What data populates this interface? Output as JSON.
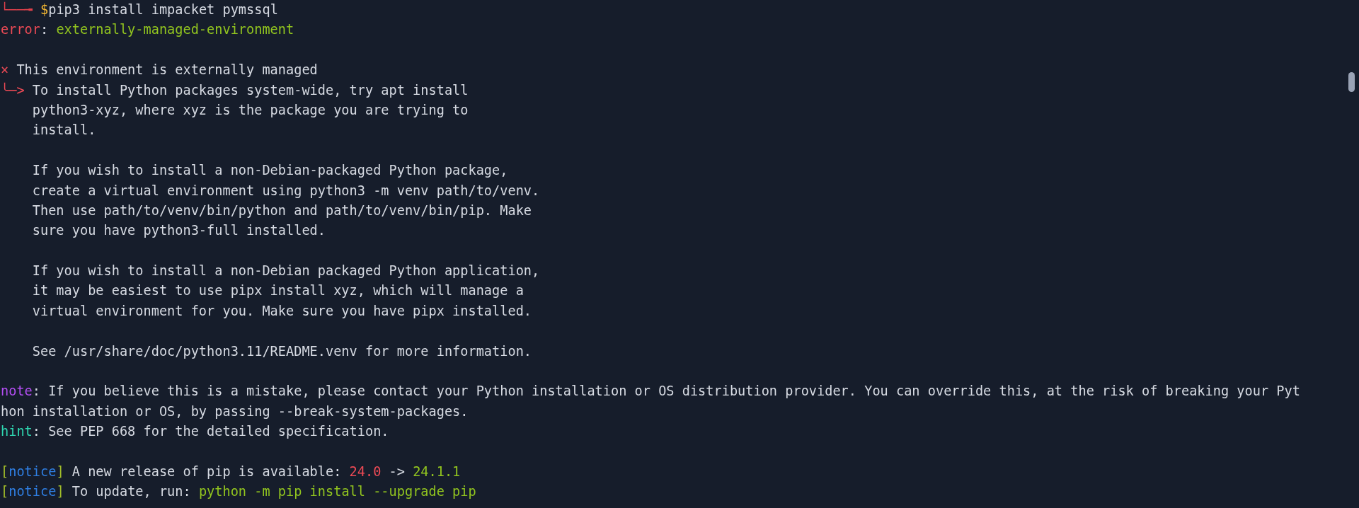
{
  "terminal": {
    "lines": [
      {
        "kind": "text",
        "segments": [
          {
            "text": "└──╼ ",
            "kind": "prompt"
          },
          {
            "text": "$",
            "kind": "dollar"
          },
          {
            "text": "pip3 install impacket pymssql",
            "kind": "plain"
          }
        ]
      },
      {
        "kind": "text",
        "segments": [
          {
            "text": "error",
            "kind": "error"
          },
          {
            "text": ": ",
            "kind": "plain"
          },
          {
            "text": "externally-managed-environment",
            "kind": "green"
          }
        ]
      },
      {
        "kind": "blank"
      },
      {
        "kind": "text",
        "segments": [
          {
            "text": "×",
            "kind": "error"
          },
          {
            "text": " This environment is externally managed",
            "kind": "plain"
          }
        ]
      },
      {
        "kind": "text",
        "segments": [
          {
            "text": "╰─>",
            "kind": "error"
          },
          {
            "text": " To install Python packages system-wide, try apt install",
            "kind": "plain"
          }
        ]
      },
      {
        "kind": "text",
        "segments": [
          {
            "text": "    python3-xyz, where xyz is the package you are trying to",
            "kind": "plain"
          }
        ]
      },
      {
        "kind": "text",
        "segments": [
          {
            "text": "    install.",
            "kind": "plain"
          }
        ]
      },
      {
        "kind": "blank"
      },
      {
        "kind": "text",
        "segments": [
          {
            "text": "    If you wish to install a non-Debian-packaged Python package,",
            "kind": "plain"
          }
        ]
      },
      {
        "kind": "text",
        "segments": [
          {
            "text": "    create a virtual environment using python3 -m venv path/to/venv.",
            "kind": "plain"
          }
        ]
      },
      {
        "kind": "text",
        "segments": [
          {
            "text": "    Then use path/to/venv/bin/python and path/to/venv/bin/pip. Make",
            "kind": "plain"
          }
        ]
      },
      {
        "kind": "text",
        "segments": [
          {
            "text": "    sure you have python3-full installed.",
            "kind": "plain"
          }
        ]
      },
      {
        "kind": "blank"
      },
      {
        "kind": "text",
        "segments": [
          {
            "text": "    If you wish to install a non-Debian packaged Python application,",
            "kind": "plain"
          }
        ]
      },
      {
        "kind": "text",
        "segments": [
          {
            "text": "    it may be easiest to use pipx install xyz, which will manage a",
            "kind": "plain"
          }
        ]
      },
      {
        "kind": "text",
        "segments": [
          {
            "text": "    virtual environment for you. Make sure you have pipx installed.",
            "kind": "plain"
          }
        ]
      },
      {
        "kind": "blank"
      },
      {
        "kind": "text",
        "segments": [
          {
            "text": "    See /usr/share/doc/python3.11/README.venv for more information.",
            "kind": "plain"
          }
        ]
      },
      {
        "kind": "blank"
      },
      {
        "kind": "text",
        "segments": [
          {
            "text": "note",
            "kind": "note"
          },
          {
            "text": ": If you believe this is a mistake, please contact your Python installation or OS distribution provider. You can override this, at the risk of breaking your Pyt",
            "kind": "plain"
          }
        ]
      },
      {
        "kind": "text",
        "segments": [
          {
            "text": "hon installation or OS, by passing --break-system-packages.",
            "kind": "plain"
          }
        ]
      },
      {
        "kind": "text",
        "segments": [
          {
            "text": "hint",
            "kind": "hint"
          },
          {
            "text": ": See PEP 668 for the detailed specification.",
            "kind": "plain"
          }
        ]
      },
      {
        "kind": "blank"
      },
      {
        "kind": "text",
        "segments": [
          {
            "text": "[",
            "kind": "bracket"
          },
          {
            "text": "notice",
            "kind": "notice"
          },
          {
            "text": "]",
            "kind": "bracket"
          },
          {
            "text": " A new release of pip is available: ",
            "kind": "plain"
          },
          {
            "text": "24.0",
            "kind": "error"
          },
          {
            "text": " -> ",
            "kind": "plain"
          },
          {
            "text": "24.1.1",
            "kind": "green"
          }
        ]
      },
      {
        "kind": "text",
        "segments": [
          {
            "text": "[",
            "kind": "bracket"
          },
          {
            "text": "notice",
            "kind": "notice"
          },
          {
            "text": "]",
            "kind": "bracket"
          },
          {
            "text": " To update, run: ",
            "kind": "plain"
          },
          {
            "text": "python -m pip install --upgrade pip",
            "kind": "green"
          }
        ]
      }
    ]
  }
}
